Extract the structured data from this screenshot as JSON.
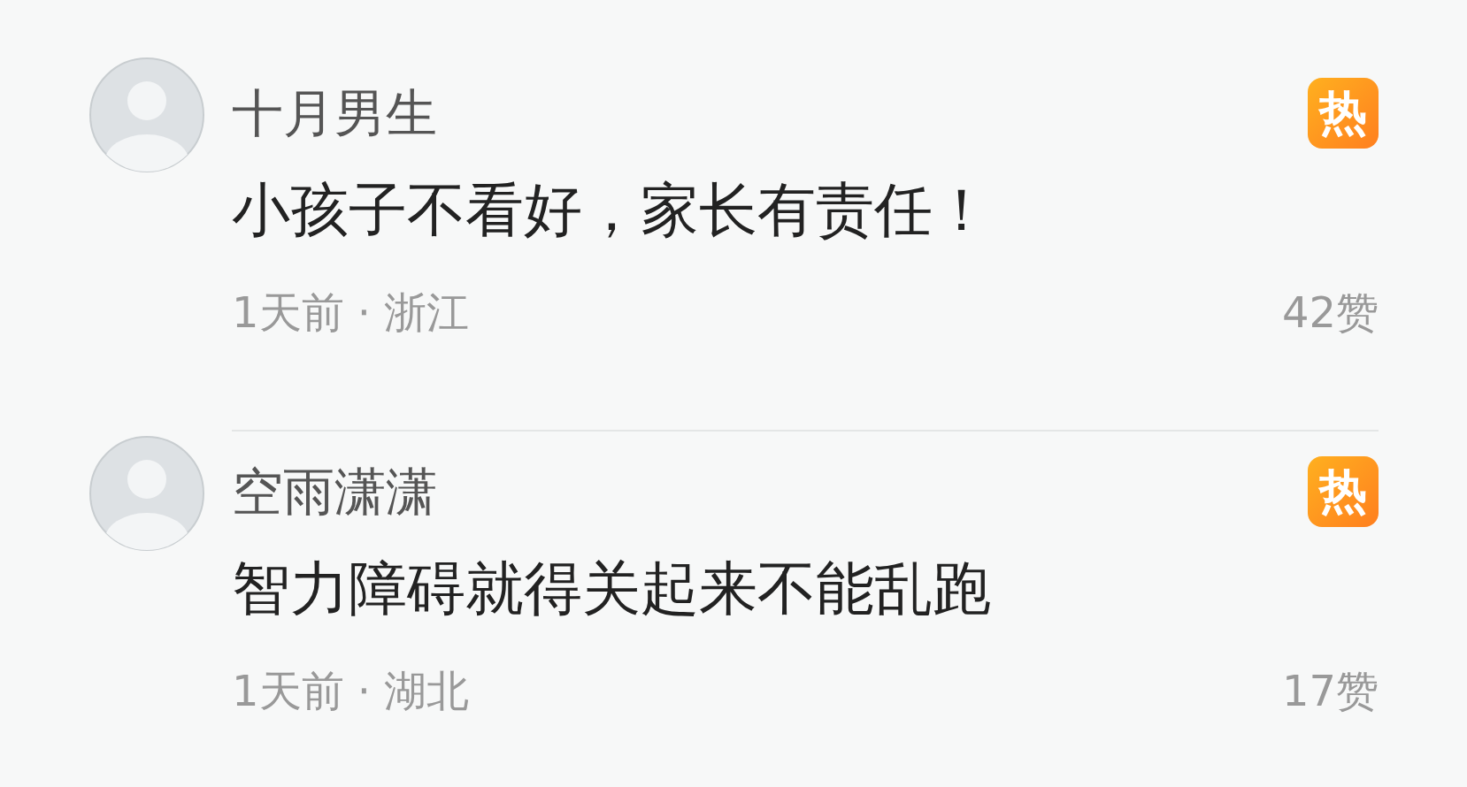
{
  "comments": [
    {
      "username": "十月男生",
      "badge": "热",
      "text": "小孩子不看好，家长有责任！",
      "meta": "1天前 · 浙江",
      "likes": "42赞"
    },
    {
      "username": "空雨潇潇",
      "badge": "热",
      "text": "智力障碍就得关起来不能乱跑",
      "meta": "1天前 · 湖北",
      "likes": "17赞"
    }
  ]
}
